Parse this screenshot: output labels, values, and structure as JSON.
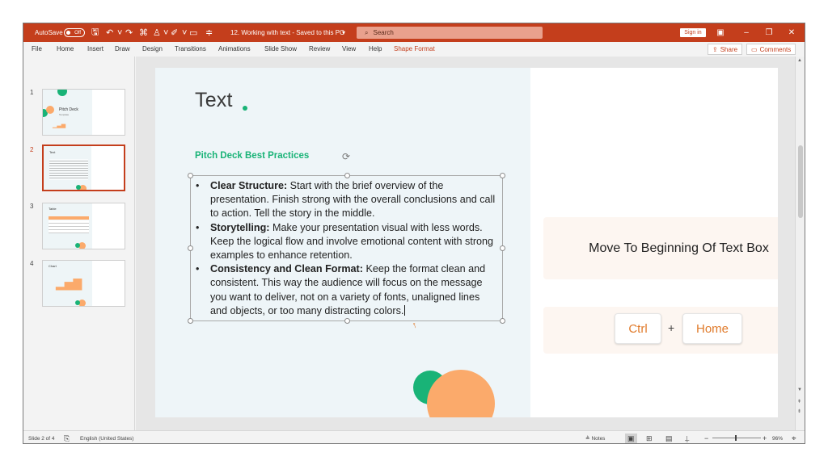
{
  "titlebar": {
    "autosave_label": "AutoSave",
    "autosave_state": "Off",
    "doc_title": "12. Working with text - Saved to this PC",
    "search_placeholder": "Search",
    "signin_label": "Sign in",
    "accent_color": "#c43e1c"
  },
  "menu": {
    "tabs": [
      "File",
      "Home",
      "Insert",
      "Draw",
      "Design",
      "Transitions",
      "Animations",
      "Slide Show",
      "Review",
      "View",
      "Help",
      "Shape Format"
    ],
    "share_label": "Share",
    "comments_label": "Comments"
  },
  "thumbnails": [
    {
      "num": "1",
      "title": "Pitch Deck",
      "subtitle": "Template"
    },
    {
      "num": "2",
      "title": "Text"
    },
    {
      "num": "3",
      "title": "Table"
    },
    {
      "num": "4",
      "title": "Chart"
    }
  ],
  "slide": {
    "title": "Text",
    "subtitle": "Pitch Deck Best Practices",
    "bullets": [
      {
        "bold": "Clear Structure:",
        "text": " Start with the brief overview of the presentation. Finish strong with the overall conclusions and call to action. Tell the story in the middle."
      },
      {
        "bold": "Storytelling:",
        "text": " Make your presentation visual with less words. Keep the logical flow and involve emotional content with strong examples to enhance retention."
      },
      {
        "bold": "Consistency and Clean Format:",
        "text": " Keep the format clean and consistent. This way the audience will focus on the message you want to deliver, not on a variety of fonts, unaligned lines and objects, or too many distracting colors."
      }
    ],
    "green_color": "#19b377",
    "orange_color": "#fbaa6b"
  },
  "overlay": {
    "caption": "Move To Beginning Of Text Box",
    "key1": "Ctrl",
    "plus": "+",
    "key2": "Home"
  },
  "status": {
    "slide_info": "Slide 2 of 4",
    "language": "English (United States)",
    "notes_label": "Notes",
    "zoom": "96%"
  }
}
